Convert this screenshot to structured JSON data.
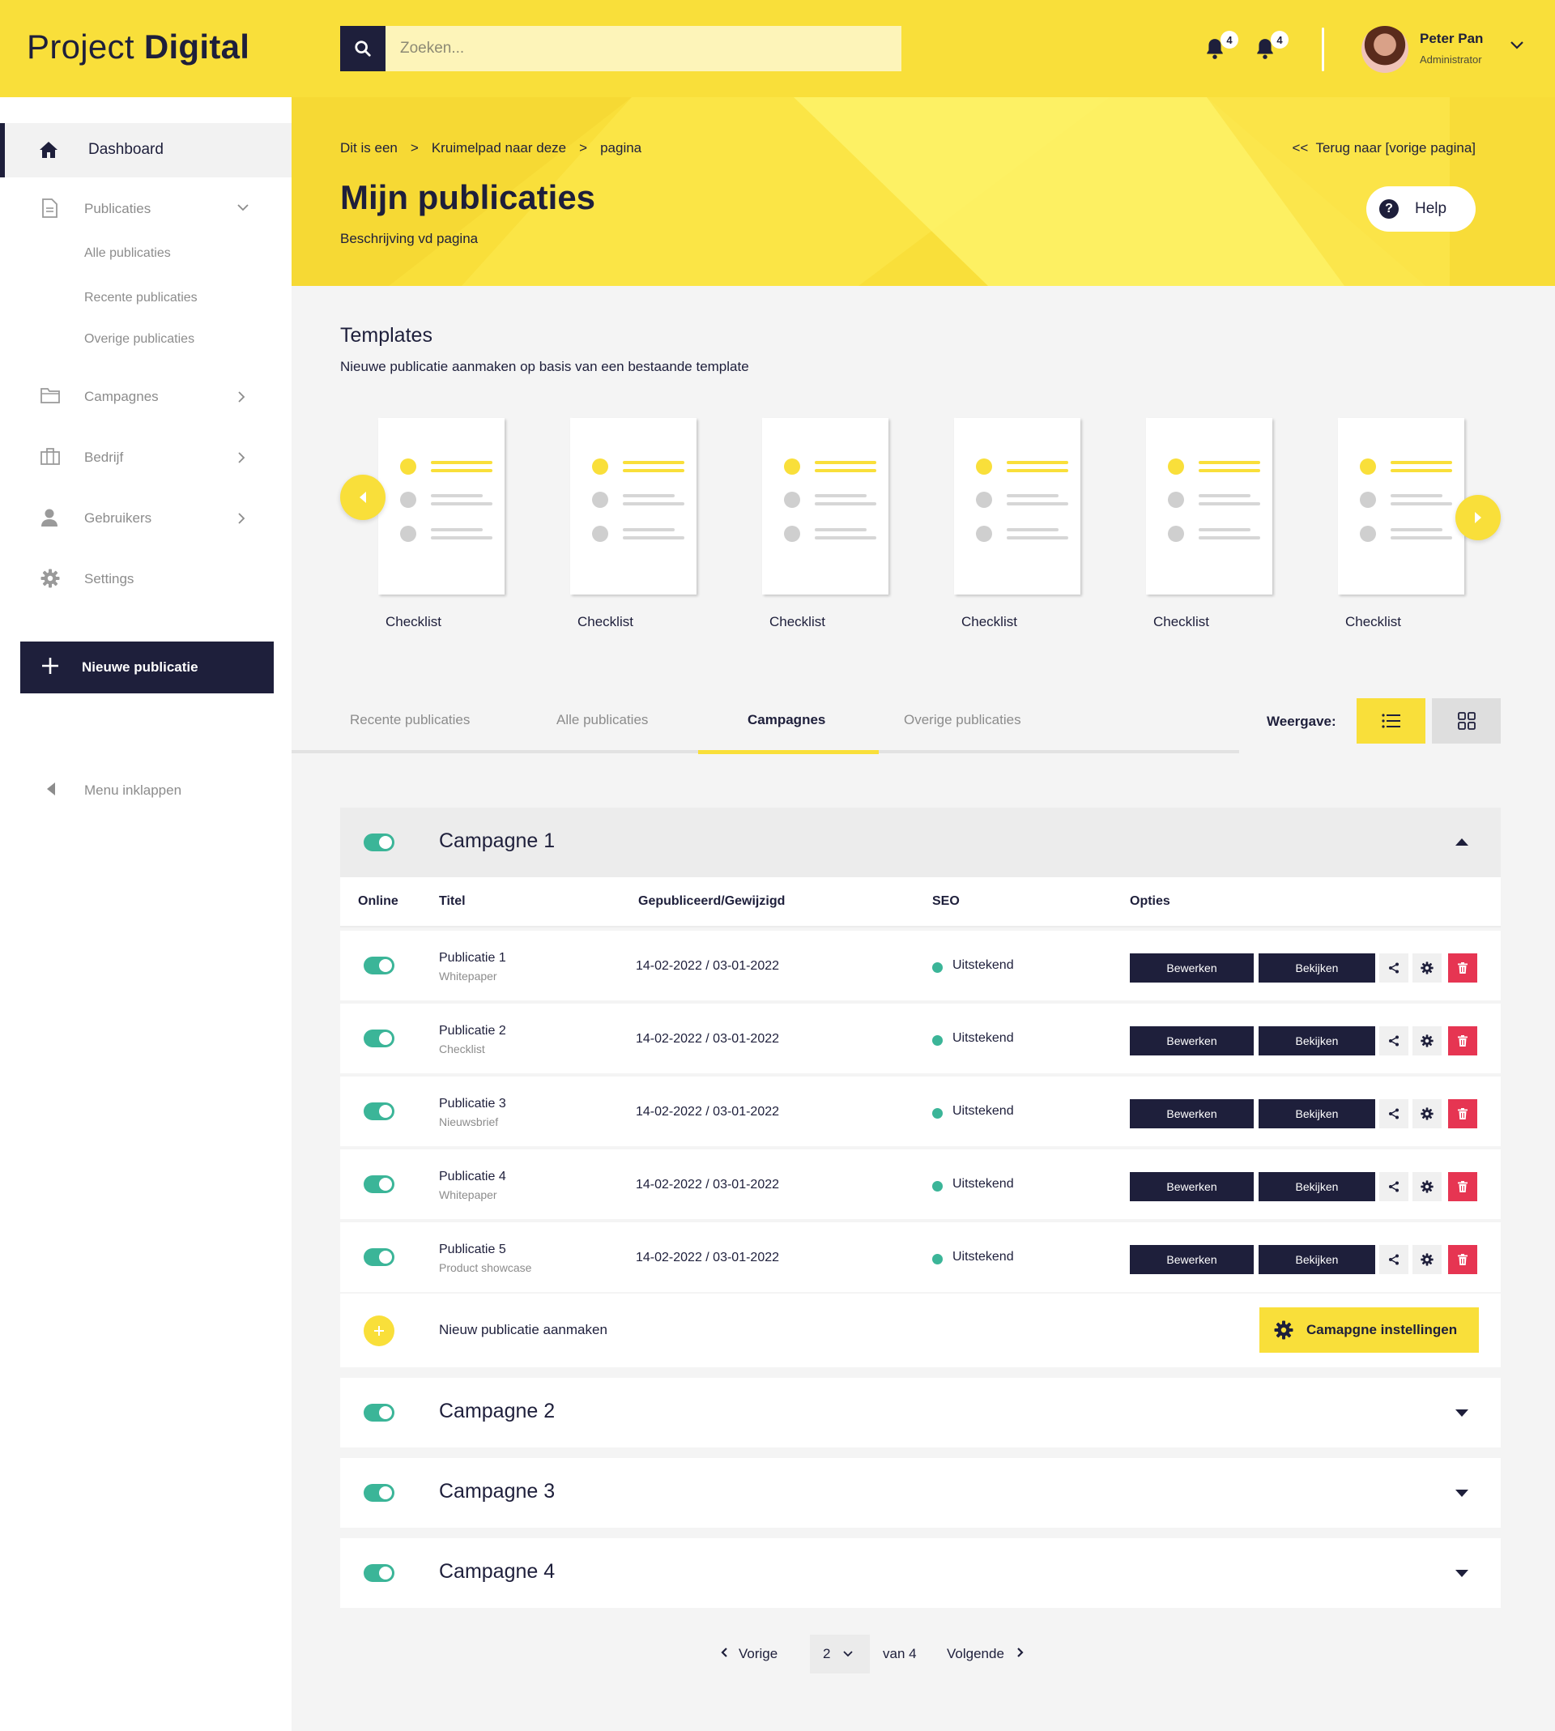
{
  "app": {
    "logo_light": "Project",
    "logo_bold": "Digital"
  },
  "search": {
    "placeholder": "Zoeken..."
  },
  "notifications": [
    {
      "count": "4"
    },
    {
      "count": "4"
    }
  ],
  "user": {
    "name": "Peter Pan",
    "role": "Administrator"
  },
  "sidebar": {
    "dashboard": "Dashboard",
    "publicaties": "Publicaties",
    "sub_items": [
      "Alle publicaties",
      "Recente publicaties",
      "Overige publicaties"
    ],
    "campagnes": "Campagnes",
    "bedrijf": "Bedrijf",
    "gebruikers": "Gebruikers",
    "settings": "Settings",
    "new_button": "Nieuwe publicatie",
    "collapse": "Menu inklappen"
  },
  "header": {
    "breadcrumbs": [
      "Dit is een",
      "Kruimelpad naar deze",
      "pagina"
    ],
    "breadcrumb_sep": ">",
    "back_link": "<<  Terug naar [vorige pagina]",
    "title": "Mijn publicaties",
    "description": "Beschrijving vd pagina",
    "help": "Help"
  },
  "templates": {
    "title": "Templates",
    "subtitle": "Nieuwe publicatie aanmaken op basis van een bestaande template",
    "items": [
      "Checklist",
      "Checklist",
      "Checklist",
      "Checklist",
      "Checklist",
      "Checklist"
    ]
  },
  "tabs": {
    "items": [
      "Recente publicaties",
      "Alle publicaties",
      "Campagnes",
      "Overige publicaties"
    ],
    "active": "Campagnes",
    "view_label": "Weergave:"
  },
  "campaigns": {
    "open": {
      "title": "Campagne 1",
      "columns": {
        "online": "Online",
        "title": "Titel",
        "date": "Gepubliceerd/Gewijzigd",
        "seo": "SEO",
        "options": "Opties"
      },
      "rows": [
        {
          "title": "Publicatie 1",
          "type": "Whitepaper",
          "date": "14-02-2022 / 03-01-2022",
          "seo": "Uitstekend"
        },
        {
          "title": "Publicatie 2",
          "type": "Checklist",
          "date": "14-02-2022 / 03-01-2022",
          "seo": "Uitstekend"
        },
        {
          "title": "Publicatie 3",
          "type": "Nieuwsbrief",
          "date": "14-02-2022 / 03-01-2022",
          "seo": "Uitstekend"
        },
        {
          "title": "Publicatie 4",
          "type": "Whitepaper",
          "date": "14-02-2022 / 03-01-2022",
          "seo": "Uitstekend"
        },
        {
          "title": "Publicatie 5",
          "type": "Product showcase",
          "date": "14-02-2022 / 03-01-2022",
          "seo": "Uitstekend"
        }
      ],
      "edit_label": "Bewerken",
      "view_label": "Bekijken",
      "new_label": "Nieuw publicatie aanmaken",
      "settings_label": "Camapgne instellingen"
    },
    "closed": [
      "Campagne 2",
      "Campagne 3",
      "Campagne 4"
    ]
  },
  "pagination": {
    "prev": "Vorige",
    "current": "2",
    "of": "van",
    "total": "4",
    "next": "Volgende"
  },
  "colors": {
    "accent": "#f9df3a",
    "dark": "#1e1f3b",
    "success": "#3bb598",
    "danger": "#e63552"
  }
}
